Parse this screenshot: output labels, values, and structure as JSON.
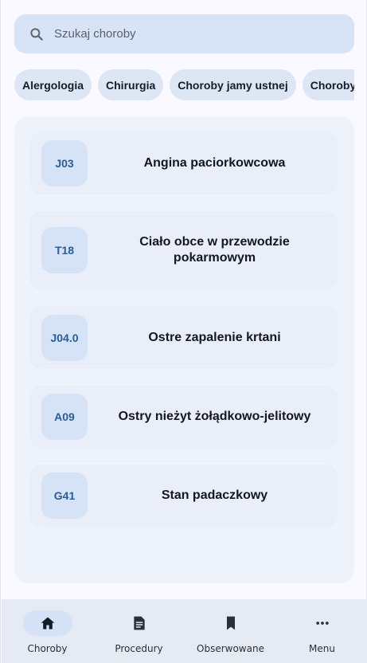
{
  "search": {
    "placeholder": "Szukaj choroby"
  },
  "categories": [
    "Alergologia",
    "Chirurgia",
    "Choroby jamy ustnej",
    "Choroby za"
  ],
  "diseases": [
    {
      "code": "J03",
      "name": "Angina paciorkowcowa"
    },
    {
      "code": "T18",
      "name": "Ciało obce w przewodzie pokarmowym"
    },
    {
      "code": "J04.0",
      "name": "Ostre zapalenie krtani"
    },
    {
      "code": "A09",
      "name": "Ostry nieżyt żołądkowo-jelitowy"
    },
    {
      "code": "G41",
      "name": "Stan padaczkowy"
    }
  ],
  "nav": [
    {
      "label": "Choroby",
      "icon": "home-icon",
      "active": true
    },
    {
      "label": "Procedury",
      "icon": "document-icon",
      "active": false
    },
    {
      "label": "Obserwowane",
      "icon": "bookmark-icon",
      "active": false
    },
    {
      "label": "Menu",
      "icon": "more-horizontal-icon",
      "active": false
    }
  ],
  "colors": {
    "accent": "#2a5d96",
    "surface": "#f9f9ff",
    "search_bg": "#d7e3f7",
    "chip_bg": "#dde6f5",
    "panel_bg": "#eef2fa",
    "card_bg": "#e9eef8",
    "nav_bg": "#e6ebf3"
  }
}
